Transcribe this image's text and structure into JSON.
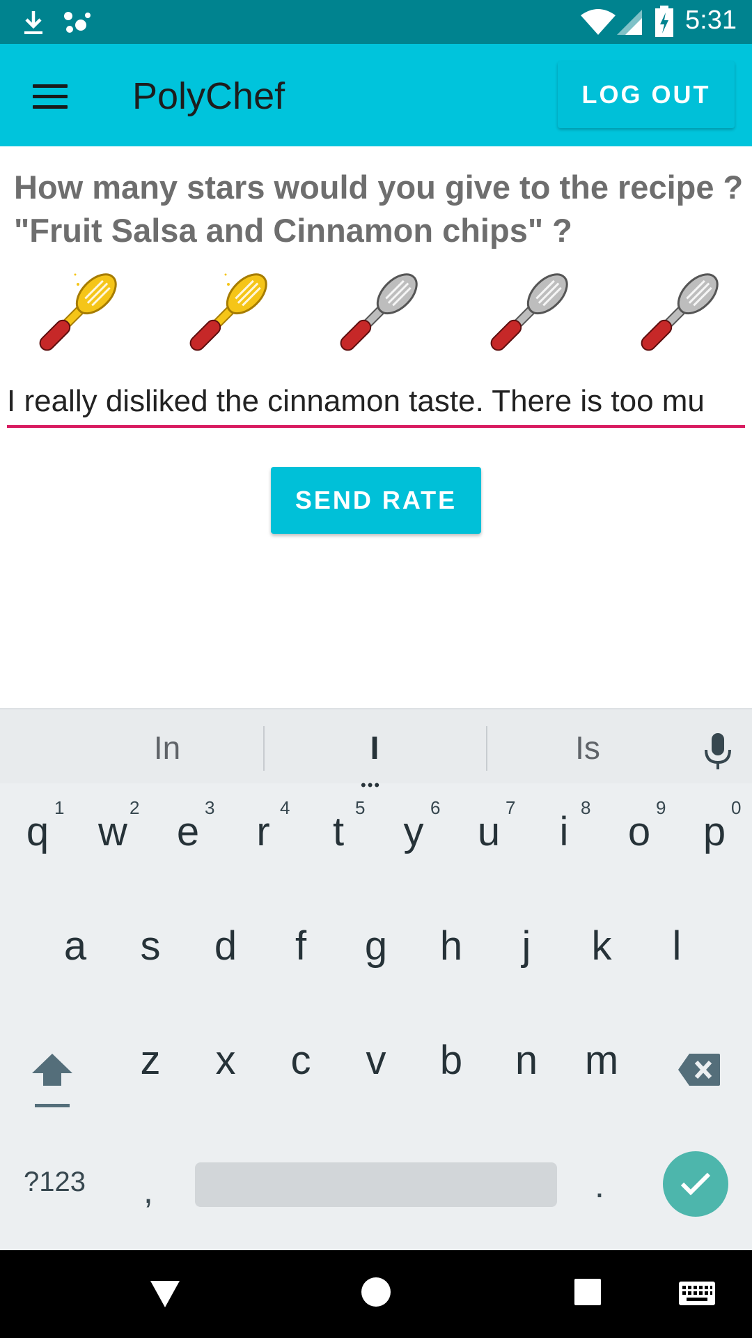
{
  "status_bar": {
    "time": "5:31",
    "icons": [
      "download-icon",
      "assistant-dots-icon",
      "wifi-icon",
      "signal-icon",
      "battery-charging-icon"
    ]
  },
  "app_bar": {
    "title": "PolyChef",
    "logout_label": "LOG OUT",
    "menu_icon": "menu-icon"
  },
  "rating": {
    "question": "How many stars would you give to the recipe ? \"Fruit Salsa and Cinnamon chips\" ?",
    "max": 5,
    "value": 2,
    "active_color": "#f5c518",
    "inactive_color": "#bdbdbd",
    "handle_color": "#c62828"
  },
  "comment": {
    "value": "I really disliked the cinnamon taste. There is too mu",
    "underline_color": "#d81b60"
  },
  "send_button": {
    "label": "SEND RATE"
  },
  "keyboard": {
    "suggestions": [
      "In",
      "I",
      "Is"
    ],
    "row1": [
      "q",
      "w",
      "e",
      "r",
      "t",
      "y",
      "u",
      "i",
      "o",
      "p"
    ],
    "row1_hints": [
      "1",
      "2",
      "3",
      "4",
      "5",
      "6",
      "7",
      "8",
      "9",
      "0"
    ],
    "row2": [
      "a",
      "s",
      "d",
      "f",
      "g",
      "h",
      "j",
      "k",
      "l"
    ],
    "row3": [
      "z",
      "x",
      "c",
      "v",
      "b",
      "n",
      "m"
    ],
    "symbols_label": "?123",
    "comma_label": ",",
    "period_label": "."
  },
  "nav_bar": {
    "icons": [
      "back-icon",
      "home-icon",
      "recents-icon",
      "keyboard-icon"
    ]
  }
}
